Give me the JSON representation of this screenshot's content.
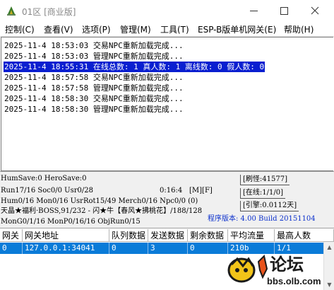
{
  "window": {
    "title": "01区 [商业版]",
    "controls": {
      "minimize": "minimize",
      "maximize": "maximize",
      "close": "close"
    }
  },
  "menu": [
    "控制(C)",
    "查看(V)",
    "选项(P)",
    "管理(M)",
    "工具(T)",
    "ESP-B版单机网关(E)",
    "帮助(H)"
  ],
  "log": [
    {
      "text": "2025-11-4 18:53:03 交易NPC重新加载完成...",
      "selected": false
    },
    {
      "text": "2025-11-4 18:53:03 管理NPC重新加载完成...",
      "selected": false
    },
    {
      "text": "2025-11-4 18:55:31 在线总数: 1 真人数: 1 离线数: 0 假人数: 0",
      "selected": true
    },
    {
      "text": "2025-11-4 18:57:58 交易NPC重新加载完成...",
      "selected": false
    },
    {
      "text": "2025-11-4 18:57:58 管理NPC重新加载完成...",
      "selected": false
    },
    {
      "text": "2025-11-4 18:58:30 交易NPC重新加载完成...",
      "selected": false
    },
    {
      "text": "2025-11-4 18:58:30 管理NPC重新加载完成...",
      "selected": false
    }
  ],
  "status": {
    "line1": "HumSave:0 HeroSave:0",
    "refresh": "[刷怪:41577]",
    "line2": "Run17/16 Soc0/0 Usr0/28",
    "clock": "0:16:4",
    "flags": "[M][F]",
    "online": "[在线:1/1/0]",
    "line3": "Hum0/16 Mon0/16 UsrRot15/49 Merch0/16 Npc0/0 (0)",
    "engine": "[引擎:0.0112天]",
    "line4": "天晶★福利·BOSS,91/232 - 闪★牛【春风★拂桃花】/188/128",
    "line5": "MonG0/1/16 MonP0/16/16 ObjRun0/15",
    "version": "程序版本: 4.00 Build 20151104"
  },
  "table": {
    "headers": [
      "网关",
      "网关地址",
      "队列数据",
      "发送数据",
      "剩余数据",
      "平均流量",
      "最高人数"
    ],
    "rows": [
      [
        "0",
        "127.0.0.1:34041",
        "0",
        "3",
        "0",
        "210b",
        "1/1"
      ]
    ]
  },
  "watermark": {
    "brand": "论坛",
    "url": "bbs.olb.com"
  }
}
